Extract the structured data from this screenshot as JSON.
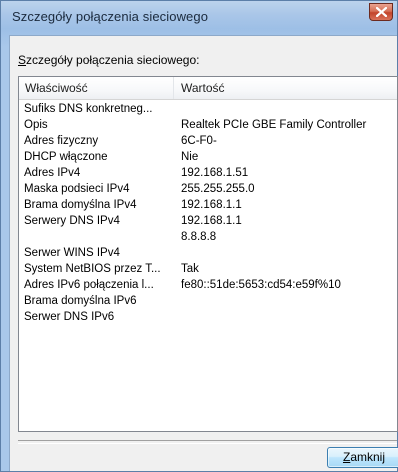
{
  "window": {
    "title": "Szczegóły połączenia sieciowego",
    "close_icon": "close-x-icon"
  },
  "caption": {
    "accel": "S",
    "rest": "zczegóły połączenia sieciowego:"
  },
  "table": {
    "headers": [
      "Właściwość",
      "Wartość"
    ],
    "rows": [
      {
        "prop": "Sufiks DNS konkretneg...",
        "val": ""
      },
      {
        "prop": "Opis",
        "val": "Realtek PCIe GBE Family Controller"
      },
      {
        "prop": "Adres fizyczny",
        "val": "6C-F0-"
      },
      {
        "prop": "DHCP włączone",
        "val": "Nie"
      },
      {
        "prop": "Adres IPv4",
        "val": "192.168.1.51"
      },
      {
        "prop": "Maska podsieci IPv4",
        "val": "255.255.255.0"
      },
      {
        "prop": "Brama domyślna IPv4",
        "val": "192.168.1.1"
      },
      {
        "prop": "Serwery DNS IPv4",
        "val": "192.168.1.1"
      },
      {
        "prop": "",
        "val": "8.8.8.8"
      },
      {
        "prop": "Serwer WINS IPv4",
        "val": ""
      },
      {
        "prop": "System NetBIOS przez T...",
        "val": "Tak"
      },
      {
        "prop": "Adres IPv6 połączenia l...",
        "val": "fe80::51de:5653:cd54:e59f%10"
      },
      {
        "prop": "Brama domyślna IPv6",
        "val": ""
      },
      {
        "prop": "Serwer DNS IPv6",
        "val": ""
      }
    ]
  },
  "footer": {
    "close_accel": "Z",
    "close_rest": "amknij"
  }
}
